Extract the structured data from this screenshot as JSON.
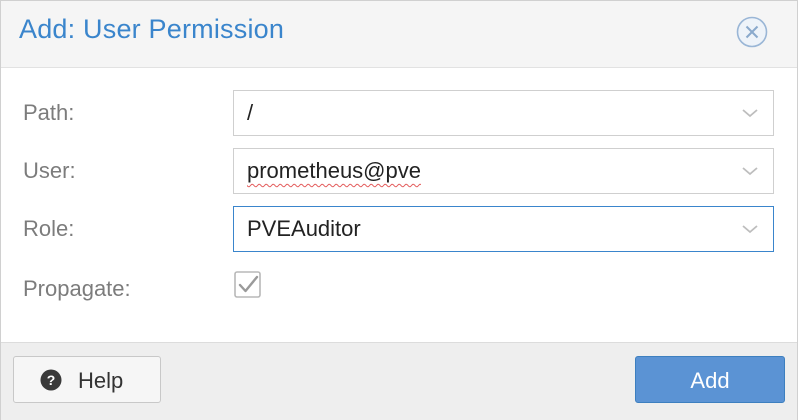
{
  "dialog": {
    "title": "Add: User Permission",
    "close_icon": "close-circle-icon"
  },
  "form": {
    "path": {
      "label": "Path:",
      "value": "/"
    },
    "user": {
      "label": "User:",
      "value": "prometheus@pve"
    },
    "role": {
      "label": "Role:",
      "value": "PVEAuditor"
    },
    "propagate": {
      "label": "Propagate:",
      "checked": true
    }
  },
  "footer": {
    "help_label": "Help",
    "help_icon": "question-circle-icon",
    "add_label": "Add"
  },
  "colors": {
    "title": "#3a85cc",
    "label": "#7c7c7c",
    "primary_button": "#5b93d4",
    "focus_border": "#3a85cc"
  }
}
